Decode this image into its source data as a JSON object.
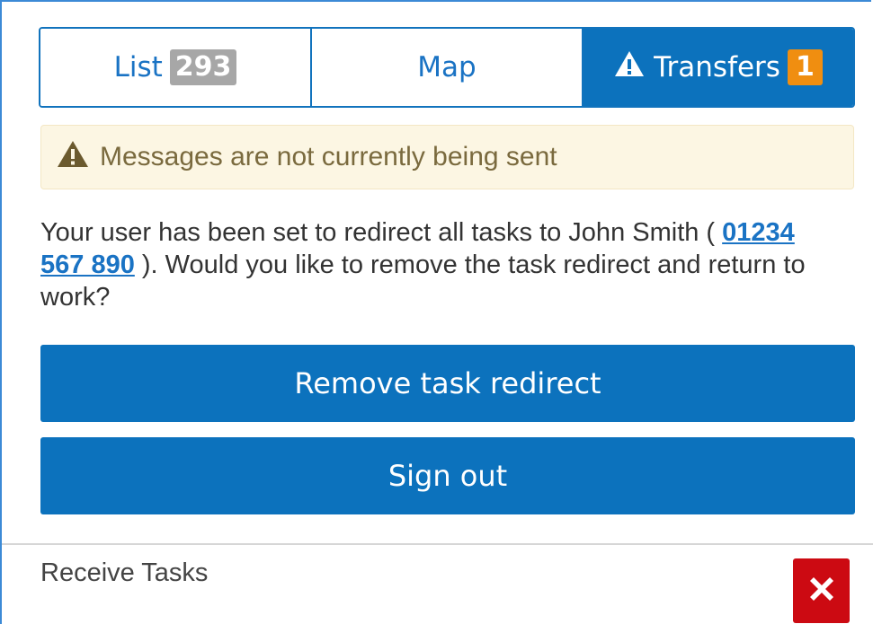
{
  "tabs": [
    {
      "label": "List",
      "badge": "293",
      "active": false
    },
    {
      "label": "Map",
      "active": false
    },
    {
      "label": "Transfers",
      "badge": "1",
      "active": true,
      "icon": "warning-icon"
    }
  ],
  "alert": {
    "icon": "warning-icon",
    "text": "Messages are not currently being sent"
  },
  "message": {
    "text_before": "Your user has been set to redirect all tasks to John Smith ( ",
    "phone": "01234 567 890",
    "text_after": " ). Would you like to remove the task redirect and return to work?"
  },
  "buttons": {
    "remove_redirect": "Remove task redirect",
    "sign_out": "Sign out"
  },
  "footer": {
    "receive_tasks_label": "Receive Tasks",
    "receive_tasks_icon": "close-icon"
  },
  "colors": {
    "primary": "#0c72bd",
    "badge_grey": "#a7a7a7",
    "badge_orange": "#f08e10",
    "alert_bg": "#fcf6e3",
    "alert_text": "#7a6a3e",
    "danger": "#cc0a12"
  }
}
